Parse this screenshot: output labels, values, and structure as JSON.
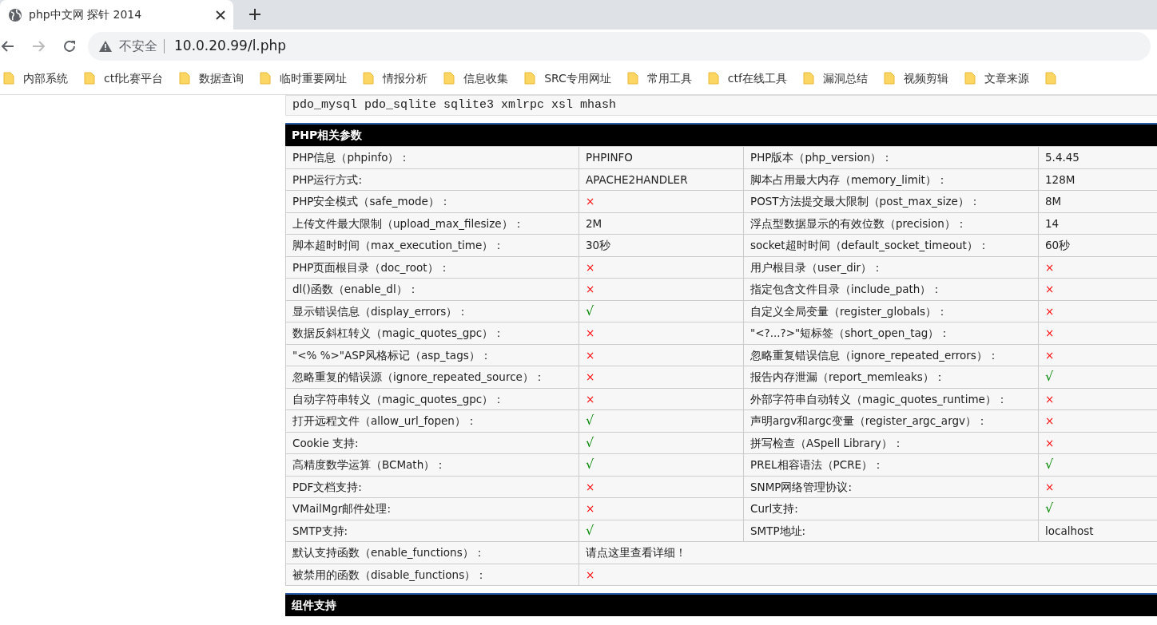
{
  "browser": {
    "tabs": [
      {
        "title": "php中文网 探针 2014",
        "selected": true
      }
    ],
    "nav": {
      "back_disabled": false,
      "forward_disabled": true
    },
    "address": {
      "security": "不安全",
      "url": "10.0.20.99/l.php"
    },
    "bookmarks": [
      {
        "label": "内部系统",
        "kind": "folder"
      },
      {
        "label": "ctf比赛平台",
        "kind": "folder"
      },
      {
        "label": "数据查询",
        "kind": "folder"
      },
      {
        "label": "临时重要网址",
        "kind": "folder"
      },
      {
        "label": "情报分析",
        "kind": "folder"
      },
      {
        "label": "信息收集",
        "kind": "folder"
      },
      {
        "label": "SRC专用网址",
        "kind": "folder"
      },
      {
        "label": "常用工具",
        "kind": "folder"
      },
      {
        "label": "ctf在线工具",
        "kind": "folder"
      },
      {
        "label": "漏洞总结",
        "kind": "folder"
      },
      {
        "label": "视频剪辑",
        "kind": "folder"
      },
      {
        "label": "文章来源",
        "kind": "folder"
      },
      {
        "kind": "folder-only"
      }
    ]
  },
  "page": {
    "extensions_line": "pdo_mysql  pdo_sqlite  sqlite3  xmlrpc  xsl  mhash",
    "sections": [
      {
        "title": "PHP相关参数",
        "rows": [
          {
            "cells": [
              {
                "kind": "label",
                "text": "PHP信息（phpinfo）："
              },
              {
                "kind": "text",
                "text": "PHPINFO"
              },
              {
                "kind": "label",
                "text": "PHP版本（php_version）："
              },
              {
                "kind": "text",
                "text": "5.4.45"
              }
            ]
          },
          {
            "cells": [
              {
                "kind": "label",
                "text": "PHP运行方式:"
              },
              {
                "kind": "text",
                "text": "APACHE2HANDLER"
              },
              {
                "kind": "label",
                "text": "脚本占用最大内存（memory_limit）："
              },
              {
                "kind": "text",
                "text": "128M"
              }
            ]
          },
          {
            "cells": [
              {
                "kind": "label",
                "text": "PHP安全模式（safe_mode）："
              },
              {
                "kind": "no",
                "text": "×"
              },
              {
                "kind": "label",
                "text": "POST方法提交最大限制（post_max_size）："
              },
              {
                "kind": "text",
                "text": "8M"
              }
            ]
          },
          {
            "cells": [
              {
                "kind": "label",
                "text": "上传文件最大限制（upload_max_filesize）："
              },
              {
                "kind": "text",
                "text": "2M"
              },
              {
                "kind": "label",
                "text": "浮点型数据显示的有效位数（precision）："
              },
              {
                "kind": "text",
                "text": "14"
              }
            ]
          },
          {
            "cells": [
              {
                "kind": "label",
                "text": "脚本超时时间（max_execution_time）："
              },
              {
                "kind": "text",
                "text": "30秒"
              },
              {
                "kind": "label",
                "text": "socket超时时间（default_socket_timeout）："
              },
              {
                "kind": "text",
                "text": "60秒"
              }
            ]
          },
          {
            "cells": [
              {
                "kind": "label",
                "text": "PHP页面根目录（doc_root）："
              },
              {
                "kind": "no",
                "text": "×"
              },
              {
                "kind": "label",
                "text": "用户根目录（user_dir）："
              },
              {
                "kind": "no",
                "text": "×"
              }
            ]
          },
          {
            "cells": [
              {
                "kind": "label",
                "text": "dl()函数（enable_dl）："
              },
              {
                "kind": "no",
                "text": "×"
              },
              {
                "kind": "label",
                "text": "指定包含文件目录（include_path）："
              },
              {
                "kind": "no",
                "text": "×"
              }
            ]
          },
          {
            "cells": [
              {
                "kind": "label",
                "text": "显示错误信息（display_errors）："
              },
              {
                "kind": "yes",
                "text": "√"
              },
              {
                "kind": "label",
                "text": "自定义全局变量（register_globals）："
              },
              {
                "kind": "no",
                "text": "×"
              }
            ]
          },
          {
            "cells": [
              {
                "kind": "label",
                "text": "数据反斜杠转义（magic_quotes_gpc）："
              },
              {
                "kind": "no",
                "text": "×"
              },
              {
                "kind": "label",
                "text": "\"<?...?>\"短标签（short_open_tag）："
              },
              {
                "kind": "no",
                "text": "×"
              }
            ]
          },
          {
            "cells": [
              {
                "kind": "label",
                "text": "\"<% %>\"ASP风格标记（asp_tags）："
              },
              {
                "kind": "no",
                "text": "×"
              },
              {
                "kind": "label",
                "text": "忽略重复错误信息（ignore_repeated_errors）："
              },
              {
                "kind": "no",
                "text": "×"
              }
            ]
          },
          {
            "cells": [
              {
                "kind": "label",
                "text": "忽略重复的错误源（ignore_repeated_source）："
              },
              {
                "kind": "no",
                "text": "×"
              },
              {
                "kind": "label",
                "text": "报告内存泄漏（report_memleaks）："
              },
              {
                "kind": "yes",
                "text": "√"
              }
            ]
          },
          {
            "cells": [
              {
                "kind": "label",
                "text": "自动字符串转义（magic_quotes_gpc）："
              },
              {
                "kind": "no",
                "text": "×"
              },
              {
                "kind": "label",
                "text": "外部字符串自动转义（magic_quotes_runtime）："
              },
              {
                "kind": "no",
                "text": "×"
              }
            ]
          },
          {
            "cells": [
              {
                "kind": "label",
                "text": "打开远程文件（allow_url_fopen）："
              },
              {
                "kind": "yes",
                "text": "√"
              },
              {
                "kind": "label",
                "text": "声明argv和argc变量（register_argc_argv）："
              },
              {
                "kind": "no",
                "text": "×"
              }
            ]
          },
          {
            "cells": [
              {
                "kind": "label",
                "text": "Cookie 支持:"
              },
              {
                "kind": "yes",
                "text": "√"
              },
              {
                "kind": "label",
                "text": "拼写检查（ASpell Library）："
              },
              {
                "kind": "no",
                "text": "×"
              }
            ]
          },
          {
            "cells": [
              {
                "kind": "label",
                "text": "高精度数学运算（BCMath）："
              },
              {
                "kind": "yes",
                "text": "√"
              },
              {
                "kind": "label",
                "text": "PREL相容语法（PCRE）："
              },
              {
                "kind": "yes",
                "text": "√"
              }
            ]
          },
          {
            "cells": [
              {
                "kind": "label",
                "text": "PDF文档支持:"
              },
              {
                "kind": "no",
                "text": "×"
              },
              {
                "kind": "label",
                "text": "SNMP网络管理协议:"
              },
              {
                "kind": "no",
                "text": "×"
              }
            ]
          },
          {
            "cells": [
              {
                "kind": "label",
                "text": "VMailMgr邮件处理:"
              },
              {
                "kind": "no",
                "text": "×"
              },
              {
                "kind": "label",
                "text": "Curl支持:"
              },
              {
                "kind": "yes",
                "text": "√"
              }
            ]
          },
          {
            "cells": [
              {
                "kind": "label",
                "text": "SMTP支持:"
              },
              {
                "kind": "yes",
                "text": "√"
              },
              {
                "kind": "label",
                "text": "SMTP地址:"
              },
              {
                "kind": "text",
                "text": "localhost"
              }
            ]
          },
          {
            "kind": "wide",
            "cells": [
              {
                "kind": "label",
                "text": "默认支持函数（enable_functions）："
              },
              {
                "kind": "link",
                "text": "请点这里查看详细！",
                "colspan": 3
              }
            ]
          },
          {
            "kind": "wide",
            "cells": [
              {
                "kind": "label",
                "text": "被禁用的函数（disable_functions）："
              },
              {
                "kind": "no",
                "text": "×",
                "colspan": 3
              }
            ]
          }
        ]
      },
      {
        "title": "组件支持"
      }
    ]
  }
}
